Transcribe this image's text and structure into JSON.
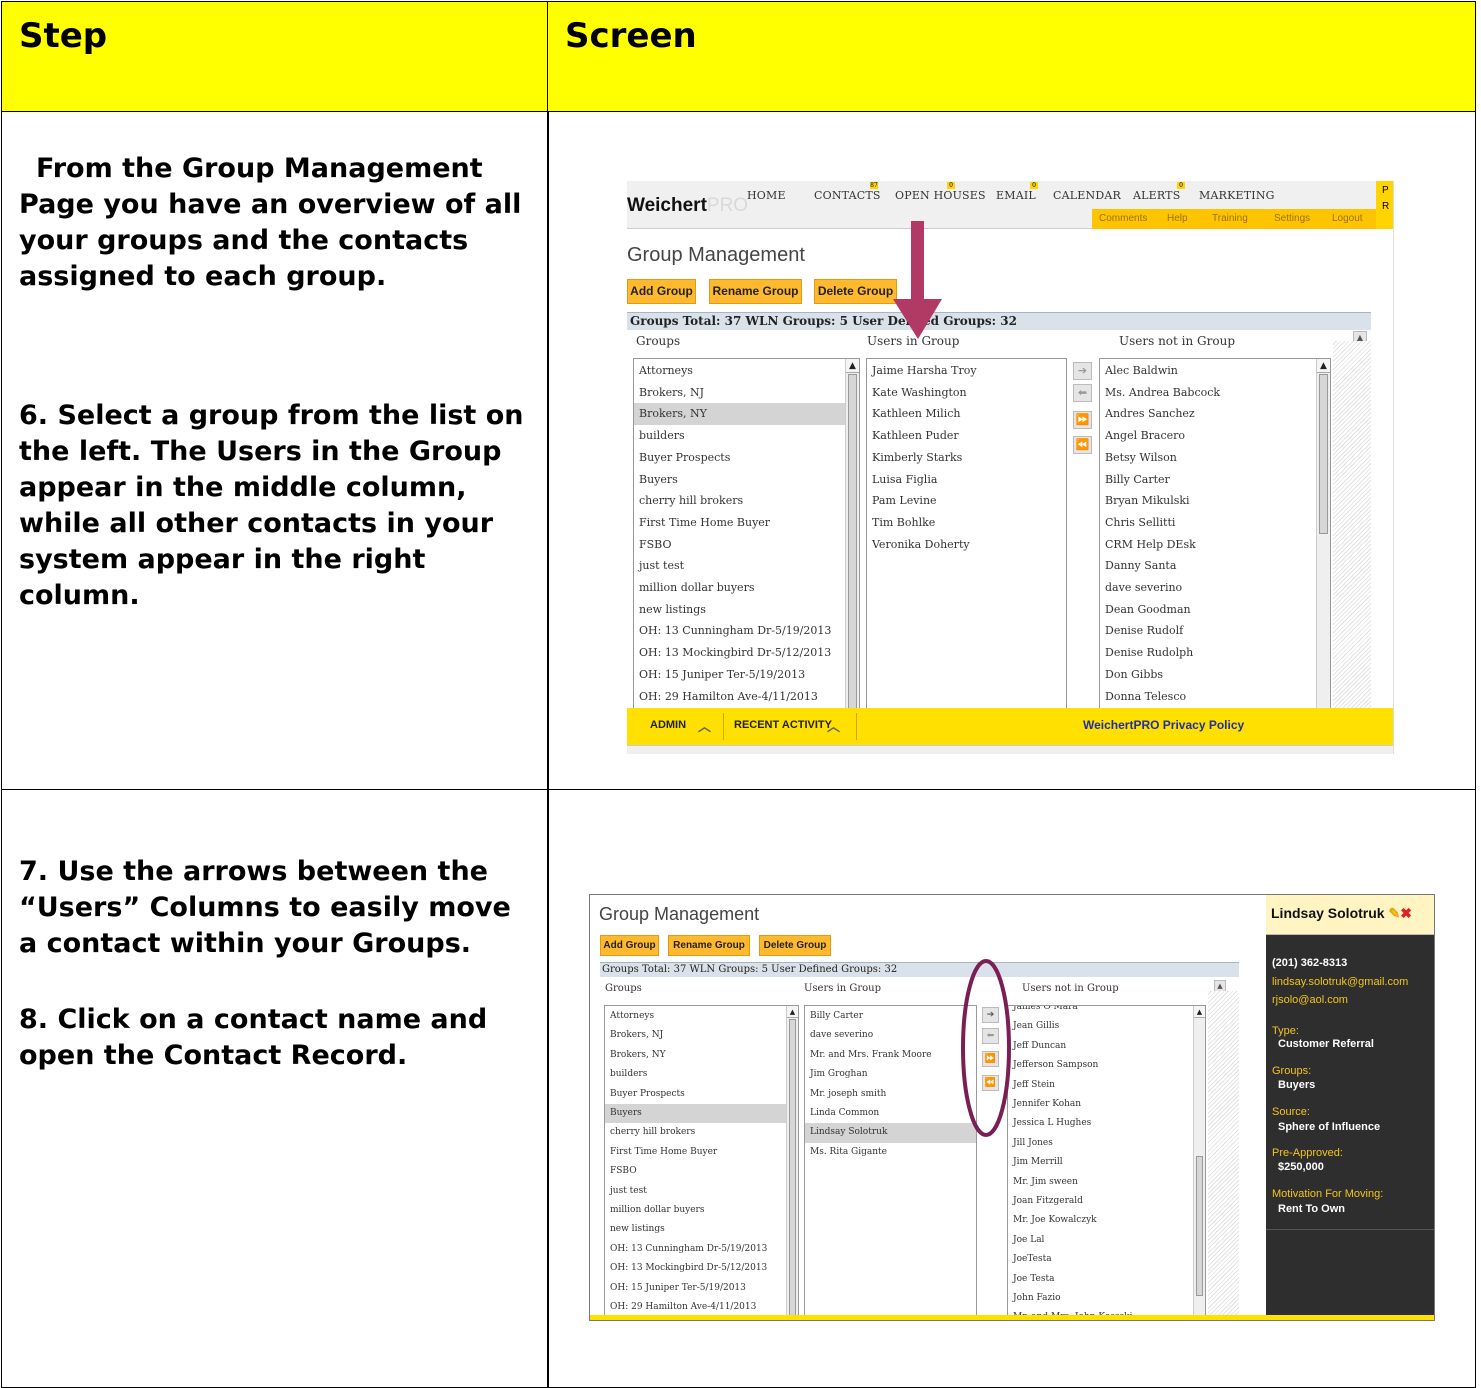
{
  "table": {
    "header_step": "Step",
    "header_screen": "Screen"
  },
  "row1": {
    "intro": "From the Group Management Page you have an overview of all your groups and the contacts assigned to each group.",
    "step6": "6.  Select a group from the list on the left.  The Users in the Group appear in the middle column, while all other contacts in your system appear in the right column."
  },
  "row2": {
    "step7": "7.  Use the arrows between the “Users” Columns to easily move a contact within your Groups.",
    "step8": "8.  Click on a contact name and open the Contact Record."
  },
  "screen1": {
    "logo_main": "Weichert",
    "logo_suffix": "PRO",
    "nav": [
      "HOME",
      "CONTACTS",
      "OPEN HOUSES",
      "EMAIL",
      "CALENDAR",
      "ALERTS",
      "MARKETING"
    ],
    "nav_badges": [
      "87",
      "0",
      "0",
      "0"
    ],
    "subnav": [
      "Comments",
      "Help",
      "Training",
      "Settings",
      "Logout"
    ],
    "page_title": "Group Management",
    "buttons": [
      "Add Group",
      "Rename Group",
      "Delete Group"
    ],
    "totals": "Groups Total: 37   WLN Groups: 5   User Defined Groups: 32",
    "col_groups": "Groups",
    "col_users_in": "Users in Group",
    "col_users_not": "Users not in Group",
    "groups": [
      "Attorneys",
      "Brokers, NJ",
      "Brokers, NY",
      "builders",
      "Buyer Prospects",
      "Buyers",
      "cherry hill brokers",
      "First Time Home Buyer",
      "FSBO",
      "just test",
      "million dollar buyers",
      "new listings",
      "OH: 13 Cunningham Dr-5/19/2013",
      "OH: 13 Mockingbird Dr-5/12/2013",
      "OH: 15 Juniper Ter-5/19/2013",
      "OH: 29 Hamilton Ave-4/11/2013"
    ],
    "users_in": [
      "Jaime Harsha Troy",
      "Kate Washington",
      "Kathleen Milich",
      "Kathleen Puder",
      "Kimberly Starks",
      "Luisa Figlia",
      "Pam Levine",
      "Tim Bohlke",
      "Veronika Doherty"
    ],
    "users_not": [
      "Alec Baldwin",
      "Ms. Andrea Babcock",
      "Andres Sanchez",
      "Angel Bracero",
      "Betsy Wilson",
      "Billy Carter",
      "Bryan Mikulski",
      "Chris Sellitti",
      "CRM Help DEsk",
      "Danny Santa",
      "dave severino",
      "Dean Goodman",
      "Denise Rudolf",
      "Denise Rudolph",
      "Don Gibbs",
      "Donna Telesco"
    ],
    "footer_admin": "ADMIN",
    "footer_recent": "RECENT ACTIVITY",
    "footer_privacy": "WeichertPRO Privacy Policy",
    "corner_text": "P R"
  },
  "screen2": {
    "page_title": "Group Management",
    "buttons": [
      "Add Group",
      "Rename Group",
      "Delete Group"
    ],
    "totals": "Groups Total: 37   WLN Groups: 5   User Defined Groups: 32",
    "col_groups": "Groups",
    "col_users_in": "Users in Group",
    "col_users_not": "Users not in Group",
    "groups": [
      "Attorneys",
      "Brokers, NJ",
      "Brokers, NY",
      "builders",
      "Buyer Prospects",
      "Buyers",
      "cherry hill brokers",
      "First Time Home Buyer",
      "FSBO",
      "just test",
      "million dollar buyers",
      "new listings",
      "OH: 13 Cunningham Dr-5/19/2013",
      "OH: 13 Mockingbird Dr-5/12/2013",
      "OH: 15 Juniper Ter-5/19/2013",
      "OH: 29 Hamilton Ave-4/11/2013"
    ],
    "users_in": [
      "Billy Carter",
      "dave severino",
      "Mr. and Mrs. Frank Moore",
      "Jim Groghan",
      "Mr. joseph smith",
      "Linda Common",
      "Lindsay Solotruk",
      "Ms. Rita Gigante"
    ],
    "users_not": [
      "James O Mara",
      "Jean Gillis",
      "Jeff Duncan",
      "Jefferson Sampson",
      "Jeff Stein",
      "Jennifer Kohan",
      "Jessica L Hughes",
      "Jill Jones",
      "Jim Merrill",
      "Mr. Jim sween",
      "Joan Fitzgerald",
      "Mr. Joe Kowalczyk",
      "Joe Lal",
      "JoeTesta",
      "Joe Testa",
      "John Fazio",
      "Mr. and Mrs. John Kossski"
    ],
    "contact": {
      "name": "Lindsay Solotruk",
      "phone": "(201) 362-8313",
      "email1": "lindsay.solotruk@gmail.com",
      "email2": "rjsolo@aol.com",
      "type_label": "Type:",
      "type_value": "Customer Referral",
      "groups_label": "Groups:",
      "groups_value": "Buyers",
      "source_label": "Source:",
      "source_value": "Sphere of Influence",
      "preapproved_label": "Pre-Approved:",
      "preapproved_value": "$250,000",
      "motivation_label": "Motivation For Moving:",
      "motivation_value": "Rent To Own"
    }
  },
  "colors": {
    "table_header": "#ffff00",
    "button_orange": "#ffb92e",
    "arrow_annotation": "#b03a64",
    "circle_annotation": "#7a1f55",
    "footer_yellow": "#ffe000",
    "panel_dark": "#2e2e2e"
  }
}
